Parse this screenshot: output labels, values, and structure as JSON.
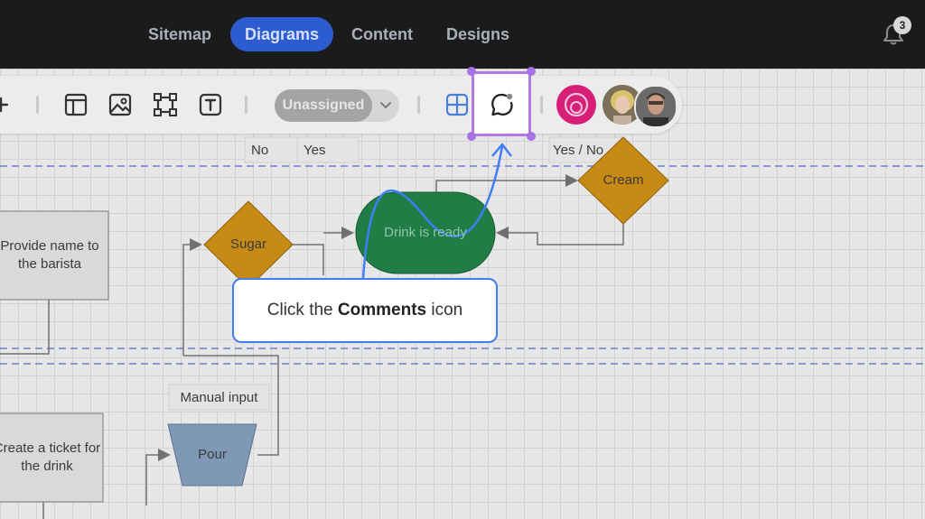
{
  "nav": {
    "items": [
      {
        "label": "Sitemap",
        "active": false
      },
      {
        "label": "Diagrams",
        "active": true
      },
      {
        "label": "Content",
        "active": false
      },
      {
        "label": "Designs",
        "active": false
      }
    ],
    "notification_count": "3"
  },
  "toolbar": {
    "tools": [
      "plus-icon",
      "layout-icon",
      "image-icon",
      "frame-icon",
      "text-icon",
      "grid-icon",
      "comments-icon"
    ],
    "assignee_label": "Unassigned"
  },
  "diagram": {
    "lane_labels": {
      "no": "No",
      "yes": "Yes",
      "yes_no": "Yes / No"
    },
    "nodes": {
      "provide_name": "Provide name to the barista",
      "sugar": "Sugar",
      "drink_ready": "Drink is ready",
      "cream": "Cream",
      "manual_input": "Manual input",
      "create_ticket": "Create a ticket for the drink",
      "pour": "Pour"
    }
  },
  "callout": {
    "prefix": "Click the ",
    "emphasis": "Comments",
    "suffix": " icon"
  },
  "colors": {
    "topbar": "#1b1b1c",
    "nav_active": "#2d5bd0",
    "callout_border": "#3f7ef7",
    "highlight": "#b07ae6",
    "decision": "#c78a14",
    "terminal": "#1f7d45",
    "process_manual": "#7f98b6"
  }
}
